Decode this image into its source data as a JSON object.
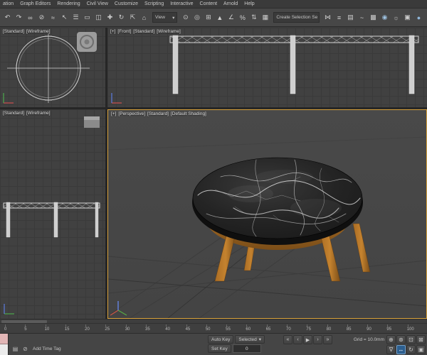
{
  "colors": {
    "active_viewport_border": "#d9a23b",
    "viewport_bg": "#414141",
    "wireframe": "#d6d6d6",
    "wood_light": "#c5832f",
    "wood_mid": "#a96c24",
    "wood_dark": "#7c4e18",
    "marble_dark": "#1c1c1c",
    "marble_vein": "#e3e3e3",
    "nav_active_bg": "#2d5f8f"
  },
  "menubar": {
    "items": [
      "ation",
      "Graph Editors",
      "Rendering",
      "Civil View",
      "Customize",
      "Scripting",
      "Interactive",
      "Content",
      "Arnold",
      "Help"
    ]
  },
  "toolbar": {
    "coord_dropdown": {
      "value": "View",
      "arrow": "▾"
    },
    "selection_set_dropdown": {
      "value": "Create Selection Se",
      "arrow": "▾"
    },
    "icons_a": [
      {
        "name": "undo-icon",
        "glyph": "↶"
      },
      {
        "name": "redo-icon",
        "glyph": "↷"
      },
      {
        "name": "select-and-link-icon",
        "glyph": "∞"
      },
      {
        "name": "unlink-selection-icon",
        "glyph": "⊘"
      },
      {
        "name": "bind-to-space-warp-icon",
        "glyph": "≈"
      },
      {
        "name": "select-object-icon",
        "glyph": "↖"
      },
      {
        "name": "select-by-name-icon",
        "glyph": "☰"
      },
      {
        "name": "selection-region-icon",
        "glyph": "▭"
      },
      {
        "name": "window-crossing-icon",
        "glyph": "◫"
      }
    ],
    "icons_b": [
      {
        "name": "select-and-move-icon",
        "glyph": "✚"
      },
      {
        "name": "select-and-rotate-icon",
        "glyph": "↻"
      },
      {
        "name": "select-and-scale-icon",
        "glyph": "⇱"
      },
      {
        "name": "select-and-place-icon",
        "glyph": "⌂"
      }
    ],
    "icons_c": [
      {
        "name": "use-pivot-center-icon",
        "glyph": "⊙"
      },
      {
        "name": "select-and-manipulate-icon",
        "glyph": "◎"
      },
      {
        "name": "keyboard-override-icon",
        "glyph": "⊞"
      },
      {
        "name": "snaps-toggle-icon",
        "glyph": "▲"
      },
      {
        "name": "angle-snap-icon",
        "glyph": "∠"
      },
      {
        "name": "percent-snap-icon",
        "glyph": "%"
      },
      {
        "name": "spinner-snap-icon",
        "glyph": "⇅"
      },
      {
        "name": "edit-selection-sets-icon",
        "glyph": "▦"
      }
    ],
    "icons_d": [
      {
        "name": "mirror-icon",
        "glyph": "⋈"
      },
      {
        "name": "align-icon",
        "glyph": "≡"
      },
      {
        "name": "scene-explorer-icon",
        "glyph": "▤"
      },
      {
        "name": "curve-editor-icon",
        "glyph": "~"
      },
      {
        "name": "schematic-view-icon",
        "glyph": "▩"
      },
      {
        "name": "material-editor-icon",
        "glyph": "◉",
        "color": "#9dc1e0"
      },
      {
        "name": "render-setup-icon",
        "glyph": "☼"
      },
      {
        "name": "rendered-frame-icon",
        "glyph": "▣"
      },
      {
        "name": "render-production-icon",
        "glyph": "●",
        "color": "#8fb6d9"
      }
    ]
  },
  "viewports": {
    "top": {
      "label_segments": [
        "[Standard]",
        "[Wireframe]"
      ]
    },
    "front": {
      "label_segments": [
        "[+]",
        "[Front]",
        "[Standard]",
        "[Wireframe]"
      ]
    },
    "left": {
      "label_segments": [
        "[Standard]",
        "[Wireframe]"
      ]
    },
    "perspective": {
      "label_segments": [
        "[+]",
        "[Perspective]",
        "[Standard]",
        "[Default Shading]"
      ]
    }
  },
  "timeline": {
    "ticks": [
      "0",
      "5",
      "10",
      "15",
      "20",
      "25",
      "30",
      "35",
      "40",
      "45",
      "50",
      "55",
      "60",
      "65",
      "70",
      "75",
      "80",
      "85",
      "90",
      "95",
      "100"
    ]
  },
  "statusbar": {
    "status_icons": [
      {
        "name": "notes-icon",
        "glyph": "▤"
      },
      {
        "name": "selection-lock-icon",
        "glyph": "⊘"
      }
    ],
    "add_time_tag": "Add Time Tag",
    "auto_key": "Auto Key",
    "set_key": "Set Key",
    "selected_label": "Selected",
    "dd_arrow": "▾",
    "time_value": "0",
    "grid_label": "Grid = 10.0mm",
    "transport": [
      {
        "name": "go-to-start-button",
        "glyph": "«"
      },
      {
        "name": "previous-frame-button",
        "glyph": "‹"
      },
      {
        "name": "play-button",
        "glyph": "▶"
      },
      {
        "name": "next-frame-button",
        "glyph": "›"
      },
      {
        "name": "go-to-end-button",
        "glyph": "»"
      }
    ],
    "nav": [
      {
        "name": "zoom-button",
        "glyph": "⊕"
      },
      {
        "name": "zoom-all-button",
        "glyph": "⊛"
      },
      {
        "name": "zoom-extents-button",
        "glyph": "⊡"
      },
      {
        "name": "zoom-extents-all-button",
        "glyph": "⊠"
      },
      {
        "name": "field-of-view-button",
        "glyph": "∇"
      },
      {
        "name": "pan-view-button",
        "glyph": "↔",
        "active": true
      },
      {
        "name": "orbit-button",
        "glyph": "↻"
      },
      {
        "name": "maximize-viewport-toggle",
        "glyph": "▣"
      }
    ]
  }
}
